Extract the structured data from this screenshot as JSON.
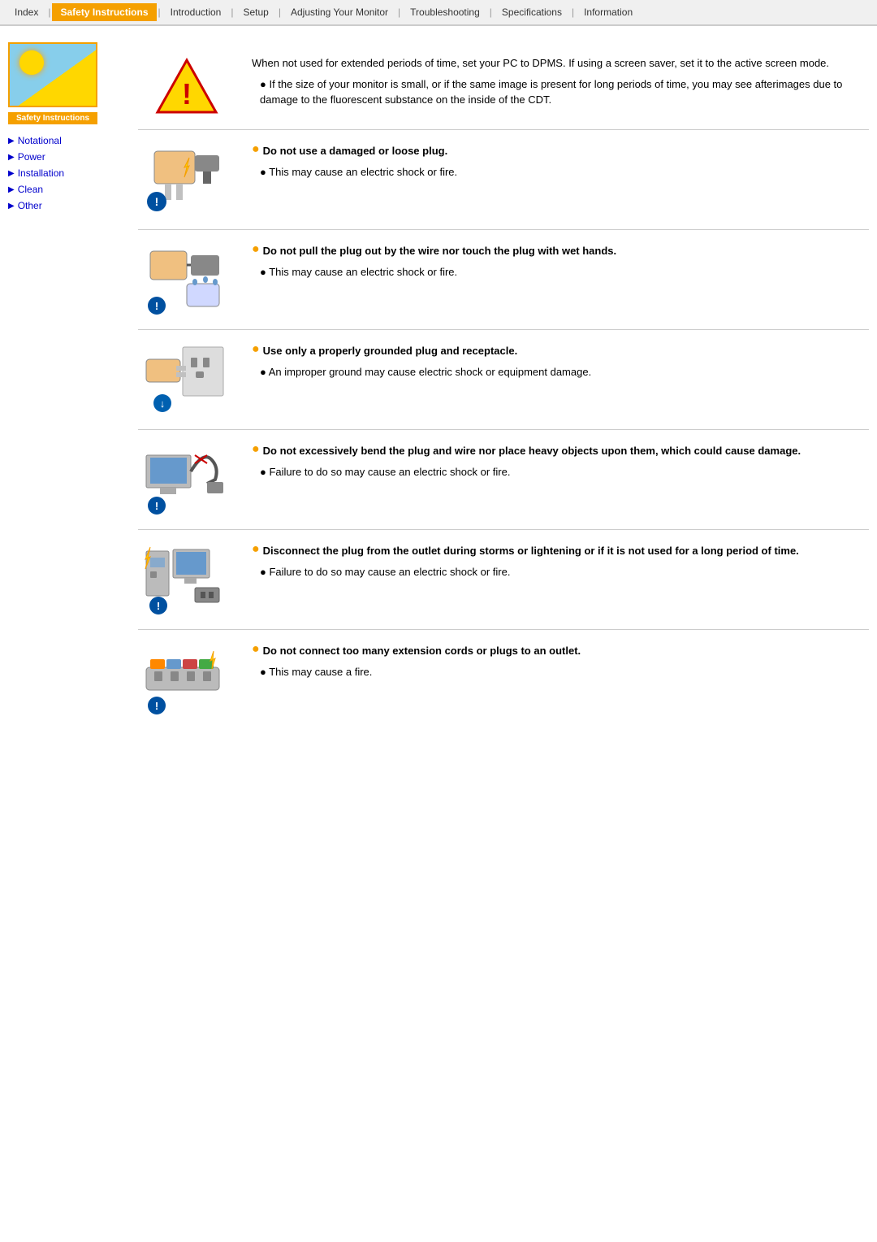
{
  "nav": {
    "items": [
      {
        "label": "Index",
        "active": false
      },
      {
        "label": "Safety Instructions",
        "active": true
      },
      {
        "label": "Introduction",
        "active": false
      },
      {
        "label": "Setup",
        "active": false
      },
      {
        "label": "Adjusting Your Monitor",
        "active": false
      },
      {
        "label": "Troubleshooting",
        "active": false
      },
      {
        "label": "Specifications",
        "active": false
      },
      {
        "label": "Information",
        "active": false
      }
    ]
  },
  "sidebar": {
    "logo_label": "Safety Instructions",
    "items": [
      {
        "label": "Notational",
        "href": "#"
      },
      {
        "label": "Power",
        "href": "#"
      },
      {
        "label": "Installation",
        "href": "#"
      },
      {
        "label": "Clean",
        "href": "#"
      },
      {
        "label": "Other",
        "href": "#"
      }
    ]
  },
  "sections": [
    {
      "id": "dpms",
      "intro": "When not used for extended periods of time, set your PC to DPMS. If using a screen saver, set it to the active screen mode.",
      "bullets": [
        "If the size of your monitor is small, or if the same image is present for long periods of time, you may see afterimages due to damage to the fluorescent substance on the inside of the CDT."
      ],
      "title": null
    },
    {
      "id": "damaged-plug",
      "intro": null,
      "title": "Do not use a damaged or loose plug.",
      "bullets": [
        "This may cause an electric shock or fire."
      ]
    },
    {
      "id": "wet-hands",
      "intro": null,
      "title": "Do not pull the plug out by the wire nor touch the plug with wet hands.",
      "bullets": [
        "This may cause an electric shock or fire."
      ]
    },
    {
      "id": "grounded",
      "intro": null,
      "title": "Use only a properly grounded plug and receptacle.",
      "bullets": [
        "An improper ground may cause electric shock or equipment damage."
      ]
    },
    {
      "id": "bend",
      "intro": null,
      "title": "Do not excessively bend the plug and wire nor place heavy objects upon them, which could cause damage.",
      "bullets": [
        "Failure to do so may cause an electric shock or fire."
      ]
    },
    {
      "id": "storm",
      "intro": null,
      "title": "Disconnect the plug from the outlet during storms or lightening or if it is not used for a long period of time.",
      "bullets": [
        "Failure to do so may cause an electric shock or fire."
      ]
    },
    {
      "id": "extension",
      "intro": null,
      "title": "Do not connect too many extension cords or plugs to an outlet.",
      "bullets": [
        "This may cause a fire."
      ]
    }
  ]
}
